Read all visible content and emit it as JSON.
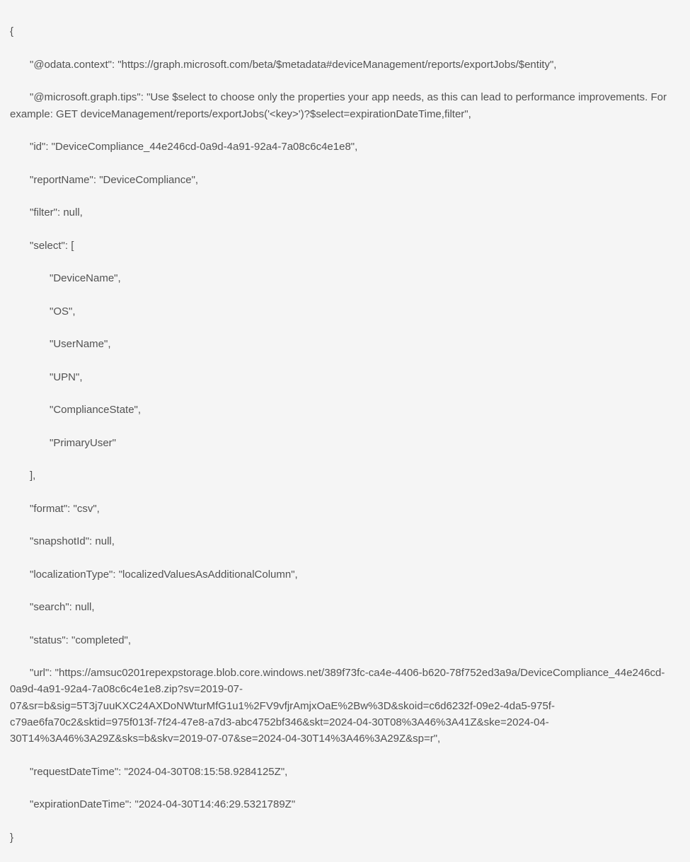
{
  "json": {
    "open_brace": "{",
    "odata_context_key": "\"@odata.context\":",
    "odata_context_val": "\"https://graph.microsoft.com/beta/$metadata#deviceManagement/reports/exportJobs/$entity\",",
    "tips_key": "\"@microsoft.graph.tips\":",
    "tips_val": "\"Use $select to choose only the properties your app needs, as this can lead to performance improvements. For example: GET deviceManagement/reports/exportJobs('<key>')?$select=expirationDateTime,filter\",",
    "id_key": "\"id\":",
    "id_val": "\"DeviceCompliance_44e246cd-0a9d-4a91-92a4-7a08c6c4e1e8\",",
    "reportName_key": "\"reportName\":",
    "reportName_val": "\"DeviceCompliance\",",
    "filter_key": "\"filter\":",
    "filter_val": "null,",
    "select_key": "\"select\":",
    "select_open": "[",
    "select_0": "\"DeviceName\",",
    "select_1": "\"OS\",",
    "select_2": "\"UserName\",",
    "select_3": "\"UPN\",",
    "select_4": "\"ComplianceState\",",
    "select_5": "\"PrimaryUser\"",
    "select_close": "],",
    "format_key": "\"format\":",
    "format_val": "\"csv\",",
    "snapshotId_key": "\"snapshotId\":",
    "snapshotId_val": "null,",
    "localizationType_key": "\"localizationType\":",
    "localizationType_val": "\"localizedValuesAsAdditionalColumn\",",
    "search_key": "\"search\":",
    "search_val": "null,",
    "status_key": "\"status\":",
    "status_val": "\"completed\",",
    "url_key": "\"url\":",
    "url_val": "\"https://amsuc0201repexpstorage.blob.core.windows.net/389f73fc-ca4e-4406-b620-78f752ed3a9a/DeviceCompliance_44e246cd-0a9d-4a91-92a4-7a08c6c4e1e8.zip?sv=2019-07-07&sr=b&sig=5T3j7uuKXC24AXDoNWturMfG1u1%2FV9vfjrAmjxOaE%2Bw%3D&skoid=c6d6232f-09e2-4da5-975f-c79ae6fa70c2&sktid=975f013f-7f24-47e8-a7d3-abc4752bf346&skt=2024-04-30T08%3A46%3A41Z&ske=2024-04-30T14%3A46%3A29Z&sks=b&skv=2019-07-07&se=2024-04-30T14%3A46%3A29Z&sp=r\",",
    "requestDateTime_key": "\"requestDateTime\":",
    "requestDateTime_val": "\"2024-04-30T08:15:58.9284125Z\",",
    "expirationDateTime_key": "\"expirationDateTime\":",
    "expirationDateTime_val": "\"2024-04-30T14:46:29.5321789Z\"",
    "close_brace": "}"
  }
}
